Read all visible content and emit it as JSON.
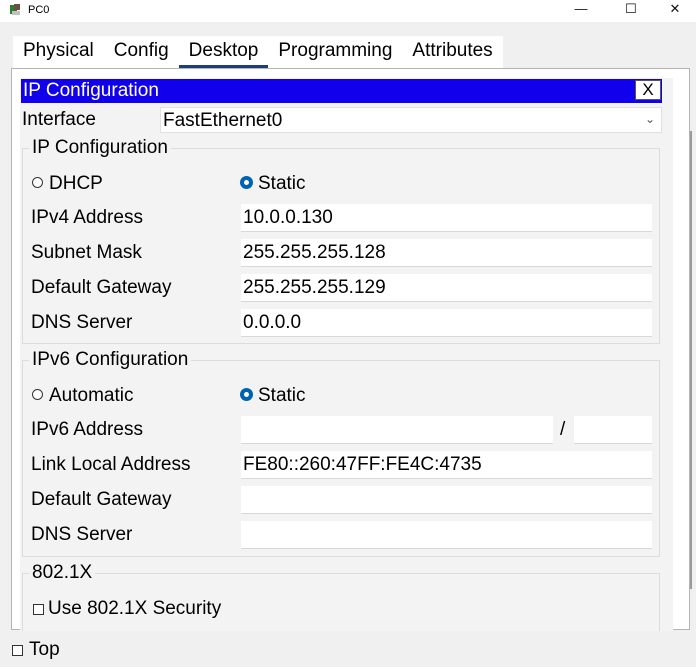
{
  "window": {
    "title": "PC0",
    "minimize": "—",
    "maximize": "☐",
    "close": "✕"
  },
  "tabs": [
    "Physical",
    "Config",
    "Desktop",
    "Programming",
    "Attributes"
  ],
  "active_tab": "Desktop",
  "header": {
    "title": "IP Configuration",
    "close_label": "X"
  },
  "interface": {
    "label": "Interface",
    "value": "FastEthernet0"
  },
  "ipv4": {
    "title": "IP Configuration",
    "dhcp_label": "DHCP",
    "static_label": "Static",
    "selected": "Static",
    "ipv4_label": "IPv4 Address",
    "ipv4_value": "10.0.0.130",
    "mask_label": "Subnet Mask",
    "mask_value": "255.255.255.128",
    "gateway_label": "Default Gateway",
    "gateway_value": "255.255.255.129",
    "dns_label": "DNS Server",
    "dns_value": "0.0.0.0"
  },
  "ipv6": {
    "title": "IPv6 Configuration",
    "auto_label": "Automatic",
    "static_label": "Static",
    "selected": "Static",
    "address_label": "IPv6 Address",
    "address_value": "",
    "prefix_sep": "/",
    "prefix_value": "",
    "link_local_label": "Link Local Address",
    "link_local_value": "FE80::260:47FF:FE4C:4735",
    "gateway_label": "Default Gateway",
    "gateway_value": "",
    "dns_label": "DNS Server",
    "dns_value": ""
  },
  "dot1x": {
    "title": "802.1X",
    "use_label": "Use 802.1X Security",
    "checked": false
  },
  "footer": {
    "top_label": "Top",
    "checked": false
  }
}
